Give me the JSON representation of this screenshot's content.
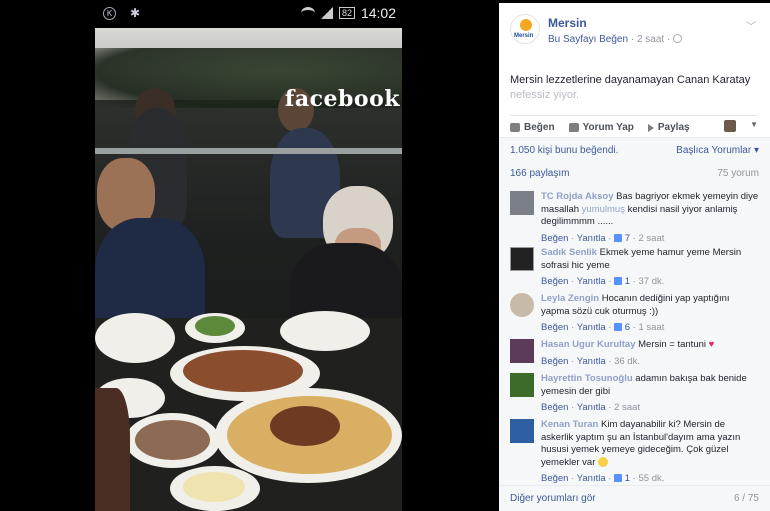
{
  "statusbar": {
    "battery": "82",
    "time": "14:02",
    "icon_left_1": "notification-icon",
    "icon_left_2": "bug-icon"
  },
  "photo": {
    "watermark": "facebook"
  },
  "post": {
    "page_name": "Mersin",
    "like_page": "Bu Sayfayı Beğen",
    "time": "2 saat",
    "text_main": "Mersin lezzetlerine dayanamayan Canan Karatay",
    "text_faded": "nefessiz yiyor."
  },
  "actions": {
    "like": "Beğen",
    "comment": "Yorum Yap",
    "share": "Paylaş"
  },
  "stats": {
    "likes": "1.050 kişi bunu beğendi.",
    "top_comments": "Başlıca Yorumlar ▾",
    "shares": "166 paylaşım",
    "comments": "75 yorum"
  },
  "comments": [
    {
      "name": "TC Rojda Aksoy",
      "text": "Bas bagriyor ekmek yemeyin diye masallah ",
      "text_blur": "yumulmuş",
      "text_after": " kendisi nasil yiyor anlamiş degilimmmm ......",
      "like": "Beğen",
      "reply": "Yanıtla",
      "likes": "7",
      "time": "2 saat"
    },
    {
      "name": "Sadık Senlik",
      "text": "Ekmek yeme hamur yeme Mersin sofrasi hic yeme",
      "like": "Beğen",
      "reply": "Yanıtla",
      "likes": "1",
      "time": "37 dk."
    },
    {
      "name": "Leyla Zengin",
      "text": "Hocanın dediğini yap yaptığını yapma sözü cuk oturmuş :))",
      "like": "Beğen",
      "reply": "Yanıtla",
      "likes": "6",
      "time": "1 saat"
    },
    {
      "name": "Hasan Ugur Kurultay",
      "text": "Mersin = tantuni",
      "like": "Beğen",
      "reply": "Yanıtla",
      "time": "36 dk."
    },
    {
      "name": "Hayrettin Tosunoğlu",
      "text": "adamın bakışa bak benide yemesin der gibi",
      "like": "Beğen",
      "reply": "Yanıtla",
      "time": "2 saat"
    },
    {
      "name": "Kenan Turan",
      "text": "Kim dayanabilir ki? Mersin de askerlik yaptım şu an İstanbul'dayım ama yazın hususi yemek yemeye gideceğim. Çok güzel yemekler var",
      "like": "Beğen",
      "reply": "Yanıtla",
      "likes": "1",
      "time": "55 dk."
    }
  ],
  "footer": {
    "more": "Diğer yorumları gör",
    "count": "6 / 75"
  }
}
